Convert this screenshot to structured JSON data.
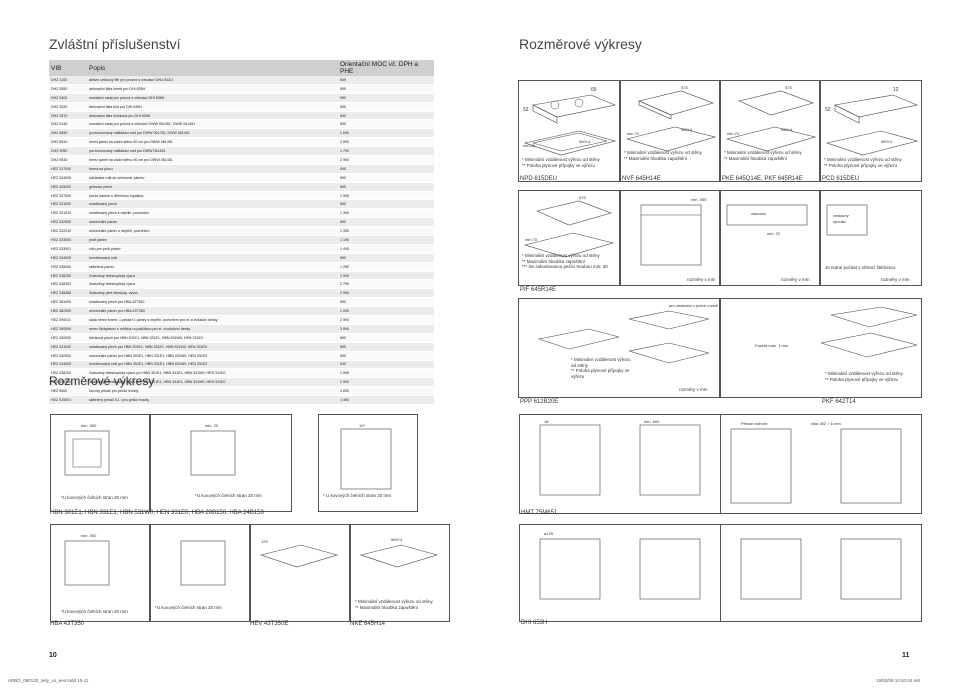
{
  "left_title": "Zvláštní příslušenství",
  "right_title": "Rozměrové výkresy",
  "mid_title": "Rozměrové výkresy",
  "table": {
    "headers": [
      "VIB",
      "Popis",
      "Orientační MOC vč. DPH a PHE"
    ],
    "rows": [
      [
        "DHZ 1100",
        "aktivní uhlíkový filtr pro provoz s cirkulací DHU 632U",
        "849"
      ],
      [
        "DHZ 3550",
        "dekorační lišta černá pro DHI 635H",
        "690"
      ],
      [
        "DHZ 3400",
        "montážní sada pro provoz s cirkulací DHI 635H",
        "990"
      ],
      [
        "DHZ 3520",
        "dekorační lišta bílá pro DHI 635H",
        "590"
      ],
      [
        "DHZ 3570",
        "dekorační lišta hliníková pro DHI 635H",
        "690"
      ],
      [
        "DHZ 5145",
        "montážní sada pro provoz s cirkulací DWW 061451, DWW 061451",
        "890"
      ],
      [
        "DHZ 6550",
        "pochromovaný odkládací rošt pro DWW 061750, DWW 061451",
        "1 690"
      ],
      [
        "DHZ 6510",
        "nerez panel na zadní stěnu 60 cm pro DWW 061451",
        "2 590"
      ],
      [
        "DHZ 9050",
        "pochromovaný odkládací rošt pro DWW 061451",
        "1 790"
      ],
      [
        "DHZ 9530",
        "nerez panel na zadní stěnu 90 cm pro DWW 061451",
        "2 990"
      ],
      [
        "HEZ 317000",
        "forma na pizzu",
        "690"
      ],
      [
        "HEZ 324000",
        "odkládací rošt do univerzál. plechu",
        "590"
      ],
      [
        "HEZ 325000",
        "grilovací plech",
        "690"
      ],
      [
        "HEZ 327000",
        "pečicí kámen s dřevěnou lopatkou",
        "1 990"
      ],
      [
        "HEZ 331000",
        "smaltovaný plech",
        "590"
      ],
      [
        "HEZ 331010",
        "smaltovaný plech s nepřiln. povrchem",
        "1 390"
      ],
      [
        "HEZ 332000",
        "univerzální pánev",
        "890"
      ],
      [
        "HEZ 332010",
        "univerzální pánev s nepřiln. povrchem",
        "1 390"
      ],
      [
        "HEZ 333000",
        "profi pánev",
        "1 190"
      ],
      [
        "HEZ 333001",
        "víko pro profi pánev",
        "1 490"
      ],
      [
        "HEZ 334000",
        "kombinovaný rošt",
        "590"
      ],
      [
        "HEZ 336000",
        "skleněná pánev",
        "1 290"
      ],
      [
        "HEZ 338250",
        "2násobný teleskopický výsuv",
        "1 990"
      ],
      [
        "HEZ 338352",
        "3násobný teleskopický výsuv",
        "2 790"
      ],
      [
        "HEZ 338358",
        "3násobný plně teleskop. výsuv",
        "2 990"
      ],
      [
        "HEZ 361000",
        "smaltovaný plech pro HBA 43T350",
        "590"
      ],
      [
        "HEZ 362000",
        "univerzální pánev pro HBA 43T350",
        "1 090"
      ],
      [
        "HEZ 390011",
        "sada nerez forem: 1 pekáč+1 pánev s nepřiln. povrchem pro el. a indukční desky",
        "2 990"
      ],
      [
        "HEZ 390090",
        "nerez Wokpánev s mřížkou a pokličkou pro el. a indukční desky",
        "3 990"
      ],
      [
        "HEZ 430000",
        "hliníková plech pro HBN 301E1, HBN 331E1, HBN 531W0, HEN 331E0",
        "690"
      ],
      [
        "HEZ 431000",
        "smaltovaný plech pro HBN 301E1, HBN 331E1, HBN 531W0, HEN 331E0",
        "590"
      ],
      [
        "HEZ 432000",
        "univerzální pánev pro HBN 301E1, HBN 331E1, HBN 531W0, HEN 331E0",
        "590"
      ],
      [
        "HEZ 434000",
        "kombinovaný rošt pro HBN 301E1, HBN 331E1, HBN 531W0, HEN 331E0",
        "540"
      ],
      [
        "HEZ 438200",
        "2násobný teleskopický výsuv pro HBN 301E1, HBN 331E1, HBN 531W0, HEN 331E0",
        "1 990"
      ],
      [
        "HEZ 438300",
        "3násobný teleskopický výsuv pro HBN 301E1, HBN 331E1, HBN 531W0, HEN 331E0",
        "2 590"
      ],
      [
        "HEZ 6000",
        "kovový pekáč pro pečicí trouby",
        "4 690"
      ],
      [
        "HEZ 915001",
        "skleněný pekáč 5,1 l pro pečicí trouby",
        "1 490"
      ]
    ]
  },
  "labels": {
    "npd": "NPD 615DEU",
    "nvf": "NVF 645H14E",
    "pke": "PKE 645Q14E, PKF 645R14E",
    "pcd": "PCD 615DEU",
    "pif": "PIF 645R14E",
    "ppp": "PPP 612B20E",
    "pkf": "PKF 642T14",
    "hbn": "HBN 301E1, HBN 331E1, HBN 531W0, HEN 331E0, HBA 20B150, HBA 24B150",
    "hmt": "HMT 75M651",
    "hba": "HBA 43T350",
    "hev": "HEV 43T350E",
    "nke": "NKE 645H14",
    "dhi": "DHI 653H"
  },
  "notes": {
    "npd": "* Minimální vzdálenost výřezu od stěny\n** Poloha plynové přípojky ve výřezu",
    "nvf": "* Minimální vzdálenost výřezu od stěny\n** Maximální hloubka zapuštění",
    "pke": "* Minimální vzdálenost výřezu od stěny\n** Maximální hloubka zapuštění",
    "pcd": "* Minimální vzdálenost výřezu od stěny\n** Poloha plynové přípojky ve výřezu",
    "pif": "* Minimální vzdálenost výřezu od stěny\n** Maximální hloubka zapuštění\n*** Se zabudovanou pečicí troubou min. 30",
    "pif_extra": "Je nutné počítat s větrací štěrbinou.",
    "ppp": "* Minimální vzdálenost výřezu od stěny\n** Poloha plynové přípojky ve výřezu",
    "pkf": "* Minimální vzdálenost výřezu od stěny\n** Poloha plynové přípojky ve výřezu",
    "nke": "* Minimální vzdálenost výřezu od stěny\n** Maximální hloubka zapuštění",
    "hbn1": "*U kovových čelních stran 20 mm",
    "hbn2": "*U kovových čelních stran 20 mm",
    "hbn3": "* U kovových čelních stran 20 mm",
    "hba1": "*U kovových čelních stran 20 mm",
    "hba2": "*U kovových čelních stran 20 mm",
    "rozmery": "rozměry v mm"
  },
  "page_numbers": {
    "left": "10",
    "right": "11"
  },
  "footer": {
    "file": "ARBO_090130_sety_vo_ee4.indd   10-11",
    "date": "19/02/09   10:40:44 AM"
  }
}
